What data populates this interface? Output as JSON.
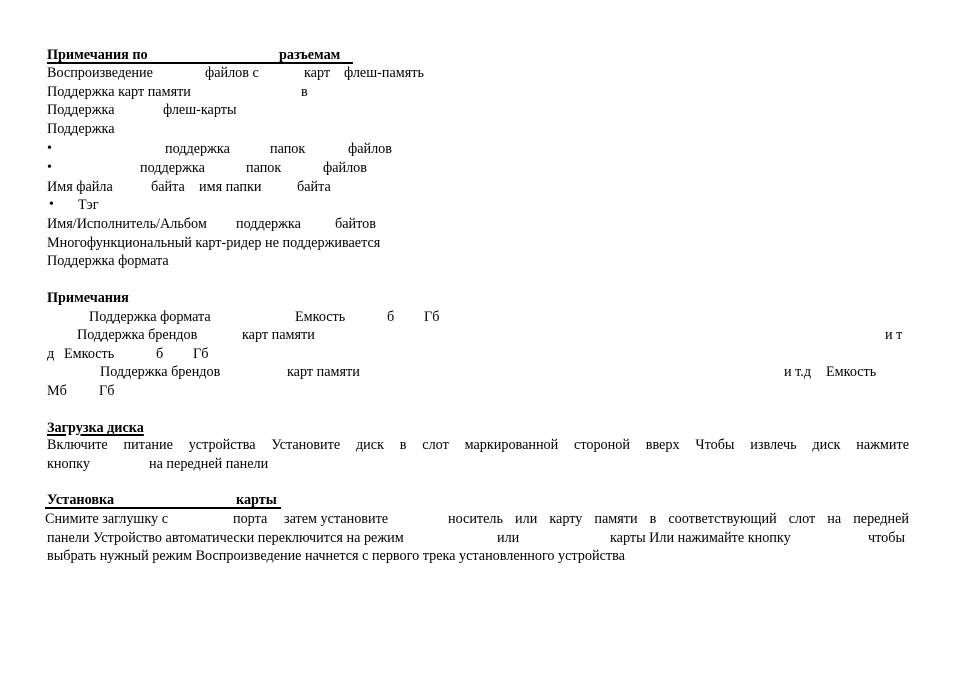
{
  "section_connectors": {
    "heading_left": "Примечания по",
    "heading_right": "разъемам",
    "line1": [
      "Воспроизведение",
      "файлов с",
      "карт",
      "флеш-память"
    ],
    "line2": [
      "Поддержка карт памяти",
      "в"
    ],
    "line3": [
      "Поддержка",
      "флеш-карты"
    ],
    "line4": "Поддержка",
    "bullet1": [
      "поддержка",
      "папок",
      "файлов"
    ],
    "bullet2": [
      "поддержка",
      "папок",
      "файлов"
    ],
    "line5": [
      "Имя файла",
      "байта",
      "имя папки",
      "байта"
    ],
    "bullet3": "Тэг",
    "line6": [
      "Имя/Исполнитель/Альбом",
      "поддержка",
      "байтов"
    ],
    "line7": "Многофункциональный карт-ридер не поддерживается",
    "line8": "Поддержка формата",
    "bullet_glyph": "•"
  },
  "section_notes": {
    "heading": "Примечания",
    "line1": [
      "Поддержка формата",
      "Емкость",
      "б",
      "Гб"
    ],
    "line2": [
      "Поддержка брендов",
      "карт памяти",
      "и т"
    ],
    "line3": [
      "д",
      "Емкость",
      "б",
      "Гб"
    ],
    "line4": [
      "Поддержка брендов",
      "карт памяти",
      "и т.д",
      "Емкость"
    ],
    "line5": [
      "Мб",
      "Гб"
    ]
  },
  "section_disc": {
    "heading": "Загрузка диска",
    "line1": "Включите питание устройства  Установите диск в слот маркированной стороной вверх  Чтобы извлечь диск  нажмите",
    "line2": [
      "кнопку",
      "на передней панели"
    ]
  },
  "section_card": {
    "heading_left": "Установка",
    "heading_right": "карты",
    "line1": [
      "Снимите заглушку с",
      "порта",
      "затем установите",
      "носитель или карту памяти в соответствующий слот на передней"
    ],
    "line2": [
      "панели  Устройство автоматически переключится на режим",
      "или",
      "карты  Или нажимайте кнопку",
      "чтобы"
    ],
    "line3": "выбрать нужный режим  Воспроизведение начнется с первого трека установленного устройства"
  }
}
